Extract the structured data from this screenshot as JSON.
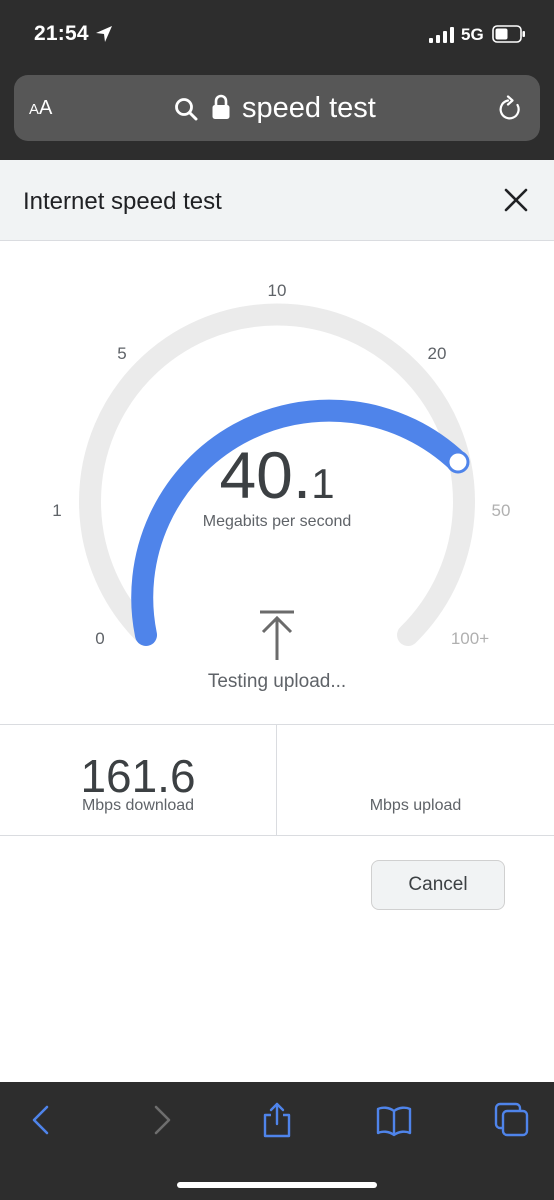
{
  "status_bar": {
    "time": "21:54",
    "network": "5G"
  },
  "address_bar": {
    "text_size_label": "AA",
    "url_text": "speed test"
  },
  "panel": {
    "title": "Internet speed test"
  },
  "gauge": {
    "ticks": [
      "0",
      "1",
      "5",
      "10",
      "20",
      "50",
      "100+"
    ],
    "current_speed": {
      "int_part": "40.",
      "frac_part": "1"
    },
    "unit": "Megabits per second",
    "status": "Testing upload...",
    "accent_color": "#4f84ea",
    "track_color": "#ebebeb"
  },
  "results": {
    "download": {
      "value": "161.6",
      "label": "Mbps download"
    },
    "upload": {
      "value": "",
      "label": "Mbps upload"
    }
  },
  "cancel_label": "Cancel",
  "toolbar": {
    "icons": [
      "back-icon",
      "forward-icon",
      "share-icon",
      "bookmarks-icon",
      "tabs-icon"
    ],
    "icon_color": "#4f84ea"
  }
}
